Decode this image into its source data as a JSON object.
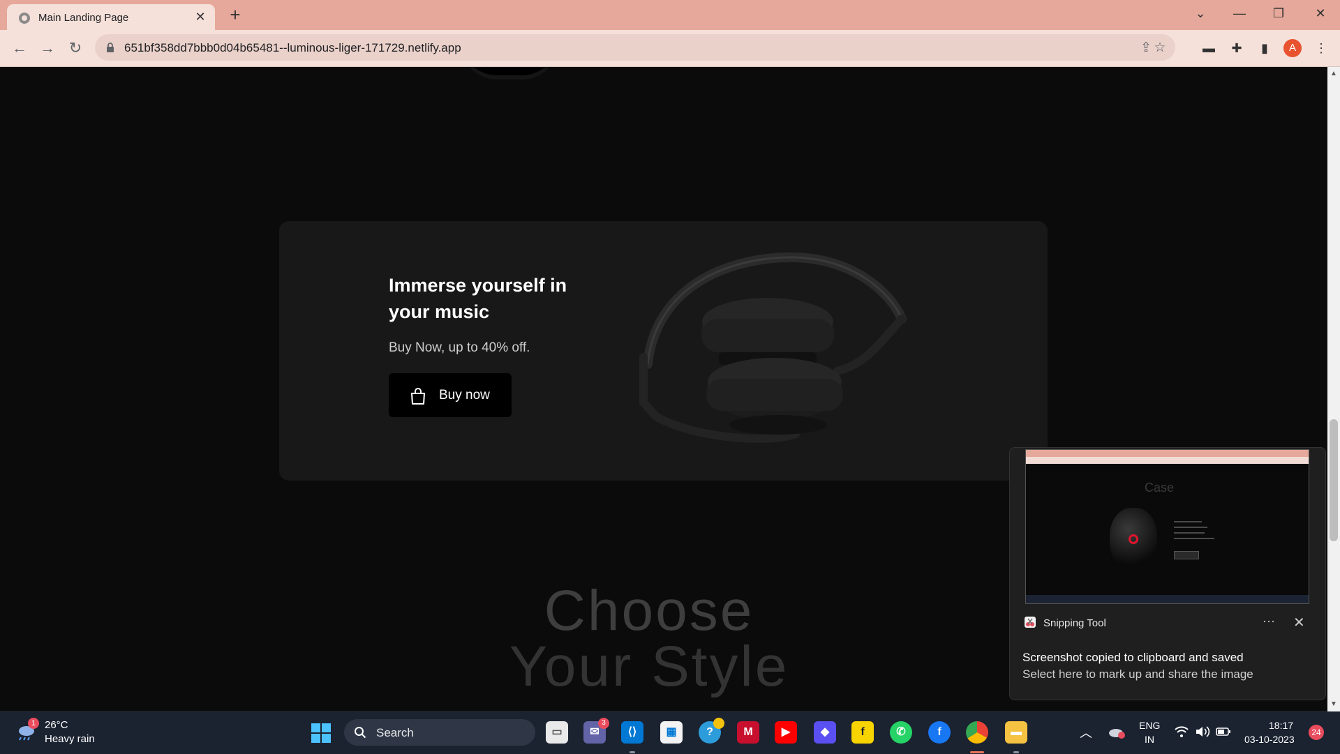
{
  "browser": {
    "tab_title": "Main Landing Page",
    "url": "651bf358dd7bbb0d04b65481--luminous-liger-171729.netlify.app",
    "profile_initial": "A"
  },
  "page": {
    "promo": {
      "heading": "Immerse yourself in your music",
      "subtitle": "Buy Now, up to 40% off.",
      "button_label": "Buy now"
    },
    "choose": {
      "line1": "Choose",
      "line2": "Your Style"
    }
  },
  "notification": {
    "app_name": "Snipping Tool",
    "title": "Screenshot copied to clipboard and saved",
    "body": "Select here to mark up and share the image",
    "more": "···",
    "preview_text": "Case"
  },
  "taskbar": {
    "weather_temp": "26°C",
    "weather_desc": "Heavy rain",
    "weather_badge": "1",
    "search_label": "Search",
    "teams_badge": "3",
    "lang_line1": "ENG",
    "lang_line2": "IN",
    "time": "18:17",
    "date": "03-10-2023",
    "notification_count": "24"
  },
  "colors": {
    "titlebar": "#e6a89a",
    "page_bg": "#0b0b0b",
    "card_bg": "#181818",
    "accent": "#e8522f"
  }
}
